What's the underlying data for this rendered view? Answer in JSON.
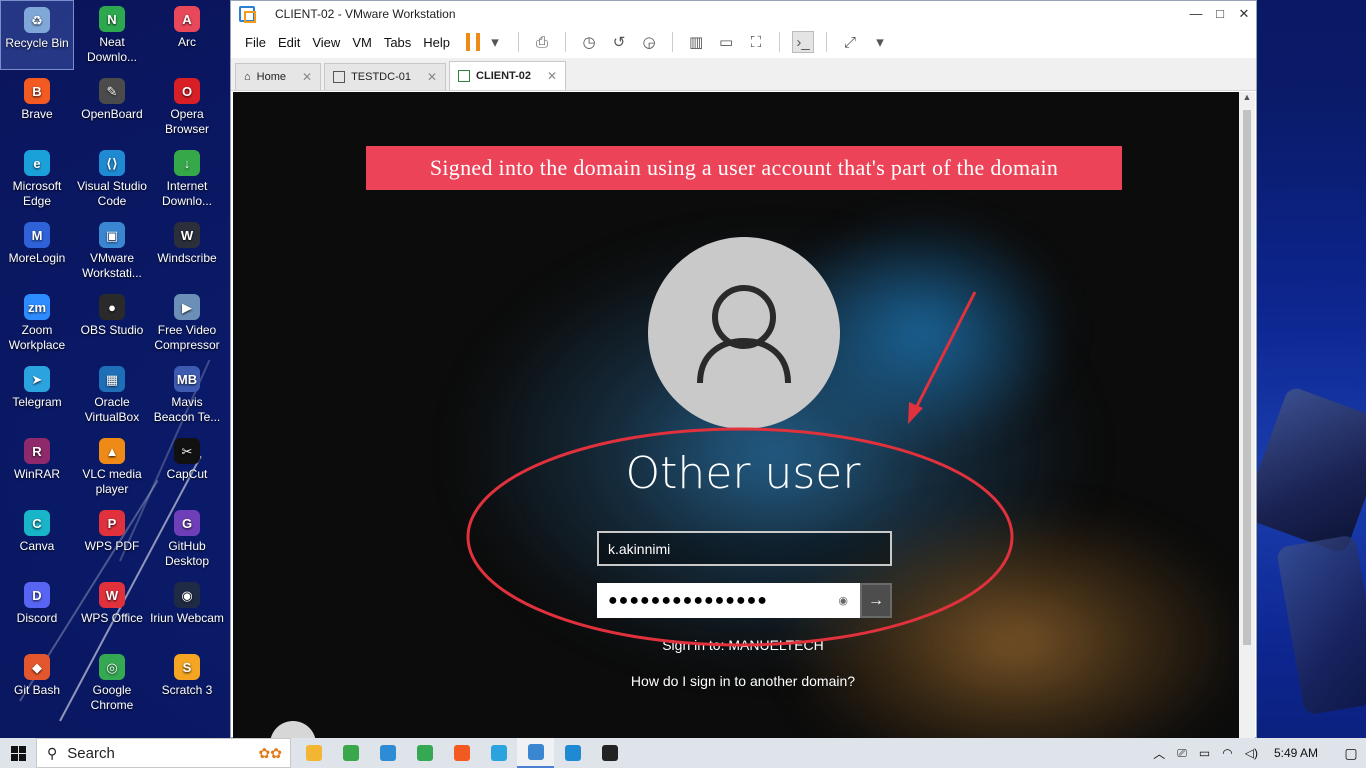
{
  "desktop": {
    "icons": [
      {
        "label": "Recycle Bin",
        "color": "#7fa8d8",
        "glyph": "♻"
      },
      {
        "label": "Neat Downlo...",
        "color": "#2ea84f",
        "glyph": "N"
      },
      {
        "label": "Arc",
        "color": "#e8485a",
        "glyph": "A"
      },
      {
        "label": "Brave",
        "color": "#f25a22",
        "glyph": "B"
      },
      {
        "label": "OpenBoard",
        "color": "#4b4b4b",
        "glyph": "✎"
      },
      {
        "label": "Opera Browser",
        "color": "#d81f26",
        "glyph": "O"
      },
      {
        "label": "Microsoft Edge",
        "color": "#1aa1d9",
        "glyph": "e"
      },
      {
        "label": "Visual Studio Code",
        "color": "#1f8ad2",
        "glyph": "⟨⟩"
      },
      {
        "label": "Internet Downlo...",
        "color": "#35a84a",
        "glyph": "↓"
      },
      {
        "label": "MoreLogin",
        "color": "#2f62d8",
        "glyph": "M"
      },
      {
        "label": "VMware Workstati...",
        "color": "#3a86d0",
        "glyph": "▣"
      },
      {
        "label": "Windscribe",
        "color": "#2b2f3a",
        "glyph": "W"
      },
      {
        "label": "Zoom Workplace",
        "color": "#2d8cff",
        "glyph": "zm"
      },
      {
        "label": "OBS Studio",
        "color": "#2a2a2a",
        "glyph": "●"
      },
      {
        "label": "Free Video Compressor",
        "color": "#6c8fb8",
        "glyph": "▶"
      },
      {
        "label": "Telegram",
        "color": "#2aa3de",
        "glyph": "➤"
      },
      {
        "label": "Oracle VirtualBox",
        "color": "#1f6fb8",
        "glyph": "▦"
      },
      {
        "label": "Mavis Beacon Te...",
        "color": "#3d5bb0",
        "glyph": "MB"
      },
      {
        "label": "WinRAR",
        "color": "#8e2a6b",
        "glyph": "R"
      },
      {
        "label": "VLC media player",
        "color": "#f08a16",
        "glyph": "▲"
      },
      {
        "label": "CapCut",
        "color": "#111111",
        "glyph": "✂"
      },
      {
        "label": "Canva",
        "color": "#18b4c7",
        "glyph": "C"
      },
      {
        "label": "WPS PDF",
        "color": "#e0313d",
        "glyph": "P"
      },
      {
        "label": "GitHub Desktop",
        "color": "#6e3fb8",
        "glyph": "G"
      },
      {
        "label": "Discord",
        "color": "#5865f2",
        "glyph": "D"
      },
      {
        "label": "WPS Office",
        "color": "#e0313d",
        "glyph": "W"
      },
      {
        "label": "Iriun Webcam",
        "color": "#1f2a44",
        "glyph": "◉"
      },
      {
        "label": "Git Bash",
        "color": "#e4572e",
        "glyph": "◆"
      },
      {
        "label": "Google Chrome",
        "color": "#34a853",
        "glyph": "◎"
      },
      {
        "label": "Scratch 3",
        "color": "#f4a623",
        "glyph": "S"
      }
    ]
  },
  "window": {
    "title": "CLIENT-02 - VMware Workstation",
    "controls": {
      "minimize": "—",
      "maximize": "□",
      "close": "✕"
    }
  },
  "menu": {
    "items": [
      "File",
      "Edit",
      "View",
      "VM",
      "Tabs",
      "Help"
    ]
  },
  "tabs": [
    {
      "label": "Home",
      "active": false
    },
    {
      "label": "TESTDC-01",
      "active": false
    },
    {
      "label": "CLIENT-02",
      "active": true
    }
  ],
  "vm": {
    "banner": "Signed into the domain using a user account that's  part of the domain",
    "login": {
      "title": "Other user",
      "username_value": "k.akinnimi",
      "password_mask": "●●●●●●●●●●●●●●●",
      "sign_in_to": "Sign in to: MANUELTECH",
      "other_domain_link": "How do I sign in to another domain?"
    },
    "annotation_color": "#e0313d"
  },
  "taskbar": {
    "search_placeholder": "Search",
    "apps": [
      {
        "name": "file-explorer",
        "color": "#f2b632"
      },
      {
        "name": "app-green",
        "color": "#3aa84a"
      },
      {
        "name": "app-diamond",
        "color": "#2e8bd6"
      },
      {
        "name": "chrome",
        "color": "#34a853"
      },
      {
        "name": "brave",
        "color": "#f25a22"
      },
      {
        "name": "telegram",
        "color": "#2aa3de"
      },
      {
        "name": "vmware",
        "color": "#3a86d0"
      },
      {
        "name": "app-vs",
        "color": "#1f8ad2"
      },
      {
        "name": "terminal",
        "color": "#222222"
      }
    ],
    "clock": "5:49 AM"
  }
}
